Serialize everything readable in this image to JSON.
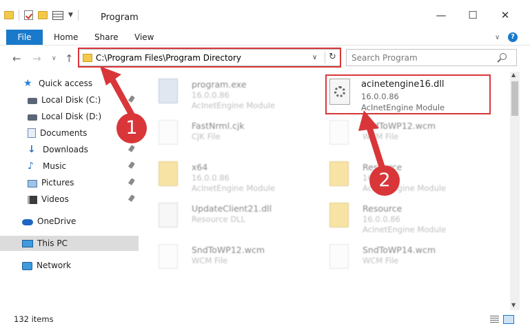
{
  "window": {
    "title": "Program"
  },
  "ribbon": {
    "file": "File",
    "home": "Home",
    "share": "Share",
    "view": "View"
  },
  "address": {
    "path": "C:\\Program Files\\Program Directory"
  },
  "search": {
    "placeholder": "Search Program"
  },
  "sidebar": {
    "items": [
      {
        "label": "Quick access"
      },
      {
        "label": "Local Disk (C:)"
      },
      {
        "label": "Local Disk (D:)"
      },
      {
        "label": "Documents"
      },
      {
        "label": "Downloads"
      },
      {
        "label": "Music"
      },
      {
        "label": "Pictures"
      },
      {
        "label": "Videos"
      },
      {
        "label": "OneDrive"
      },
      {
        "label": "This PC"
      },
      {
        "label": "Network"
      }
    ]
  },
  "files": [
    {
      "name": "program.exe",
      "line2": "16.0.0.86",
      "line3": "AcInetEngine Module"
    },
    {
      "name": "FastNrml.cjk",
      "line2": "CJK File",
      "line3": ""
    },
    {
      "name": "SndToWP12.wcm",
      "line2": "WCM File",
      "line3": ""
    },
    {
      "name": "x64",
      "line2": "16.0.0.86",
      "line3": "AcInetEngine Module"
    },
    {
      "name": "Resource",
      "line2": "16.0.0.86",
      "line3": "AcInetEngine Module"
    },
    {
      "name": "UpdateClient21.dll",
      "line2": "Resource DLL",
      "line3": ""
    },
    {
      "name": "Resource",
      "line2": "16.0.0.86",
      "line3": "AcInetEngine Module"
    },
    {
      "name": "SndToWP12.wcm",
      "line2": "WCM File",
      "line3": ""
    },
    {
      "name": "SndToWP14.wcm",
      "line2": "WCM File",
      "line3": ""
    }
  ],
  "featured_file": {
    "name": "acinetengine16.dll",
    "version": "16.0.0.86",
    "description": "AcInetEngine Module"
  },
  "status": {
    "item_count": "132 items"
  },
  "annotations": {
    "step1": "1",
    "step2": "2",
    "color": "#d9363a"
  }
}
